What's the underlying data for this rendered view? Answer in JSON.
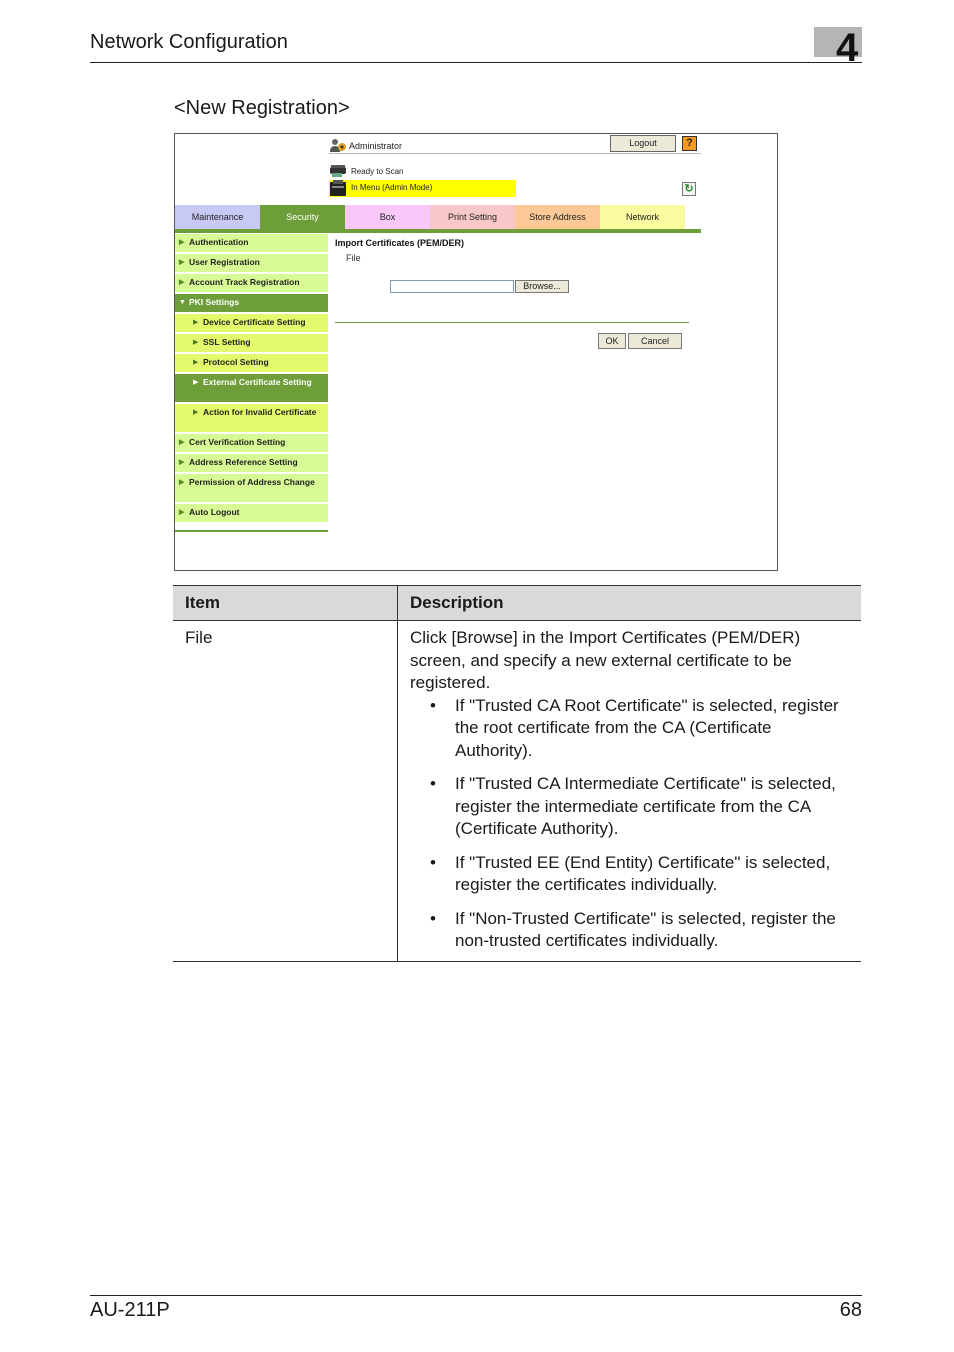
{
  "page": {
    "header_title": "Network Configuration",
    "chapter_number": "4",
    "section_title": "<New Registration>",
    "footer_left": "AU-211P",
    "footer_right": "68"
  },
  "screenshot": {
    "user": {
      "icon": "admin-user-icon",
      "label": "Administrator"
    },
    "logout_label": "Logout",
    "help_label": "?",
    "status": [
      {
        "icon": "scanner-icon",
        "label": "Ready to Scan"
      },
      {
        "icon": "printer-icon",
        "label": "In Menu (Admin Mode)",
        "highlight": "#ffff00"
      }
    ],
    "refresh_icon": "refresh-icon",
    "tabs": [
      {
        "label": "Maintenance",
        "color": "#c9c9f5"
      },
      {
        "label": "Security",
        "color": "#6e9e3a",
        "active": true
      },
      {
        "label": "Box",
        "color": "#f9c8f9"
      },
      {
        "label": "Print Setting",
        "color": "#f8c8c8"
      },
      {
        "label": "Store Address",
        "color": "#fbc896"
      },
      {
        "label": "Network",
        "color": "#fafaa0"
      }
    ],
    "sidebar": [
      {
        "label": "Authentication",
        "level": 1
      },
      {
        "label": "User Registration",
        "level": 1
      },
      {
        "label": "Account Track Registration",
        "level": 1
      },
      {
        "label": "PKI Settings",
        "level": 1,
        "expanded": true,
        "active": true
      },
      {
        "label": "Device Certificate Setting",
        "level": 2
      },
      {
        "label": "SSL Setting",
        "level": 2
      },
      {
        "label": "Protocol Setting",
        "level": 2
      },
      {
        "label": "External Certificate Setting",
        "level": 2,
        "active": true
      },
      {
        "label": "Action for Invalid Certificate",
        "level": 2
      },
      {
        "label": "Cert Verification Setting",
        "level": 1
      },
      {
        "label": "Address Reference Setting",
        "level": 1
      },
      {
        "label": "Permission of Address Change",
        "level": 1
      },
      {
        "label": "Auto Logout",
        "level": 1
      }
    ],
    "main": {
      "title": "Import Certificates (PEM/DER)",
      "file_label": "File",
      "file_value": "",
      "browse_label": "Browse...",
      "ok_label": "OK",
      "cancel_label": "Cancel"
    },
    "accent_color": "#6e9e3a"
  },
  "table": {
    "headers": [
      "Item",
      "Description"
    ],
    "rows": [
      {
        "item": "File",
        "description": "Click [Browse] in the Import Certificates (PEM/DER) screen, and specify a new external certificate to be registered.",
        "bullets": [
          "If \"Trusted CA Root Certificate\" is selected, register the root certificate from the CA (Certificate Authority).",
          "If \"Trusted CA Intermediate Certificate\" is selected, register the intermediate certificate from the CA (Certificate Authority).",
          "If \"Trusted EE (End Entity) Certificate\" is selected, register the certificates individually.",
          "If \"Non-Trusted Certificate\" is selected, register the non-trusted certificates individually."
        ]
      }
    ]
  }
}
